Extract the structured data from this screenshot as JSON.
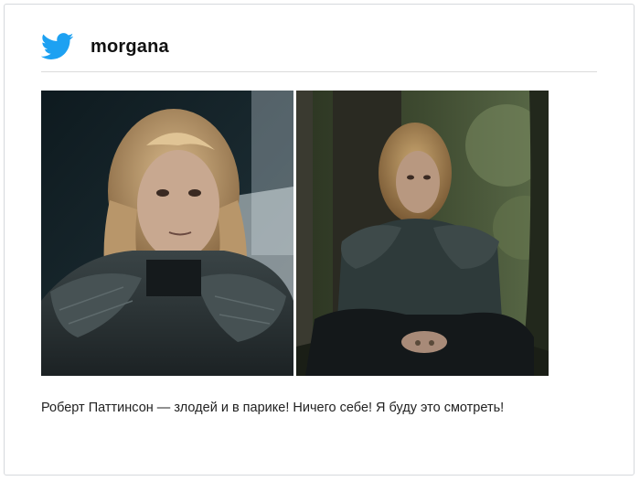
{
  "tweet": {
    "logo_icon": "twitter-bird-icon",
    "username": "morgana",
    "caption": "Роберт Паттинсон — злодей и в парике! Ничего себе! Я буду это смотреть!",
    "images": [
      {
        "description_icon": "photo-closeup-armor"
      },
      {
        "description_icon": "photo-forest-armor"
      }
    ]
  },
  "colors": {
    "twitter_blue": "#1da1f2",
    "border": "#d6d9dd",
    "divider": "#dcdcdc",
    "text": "#222222"
  }
}
